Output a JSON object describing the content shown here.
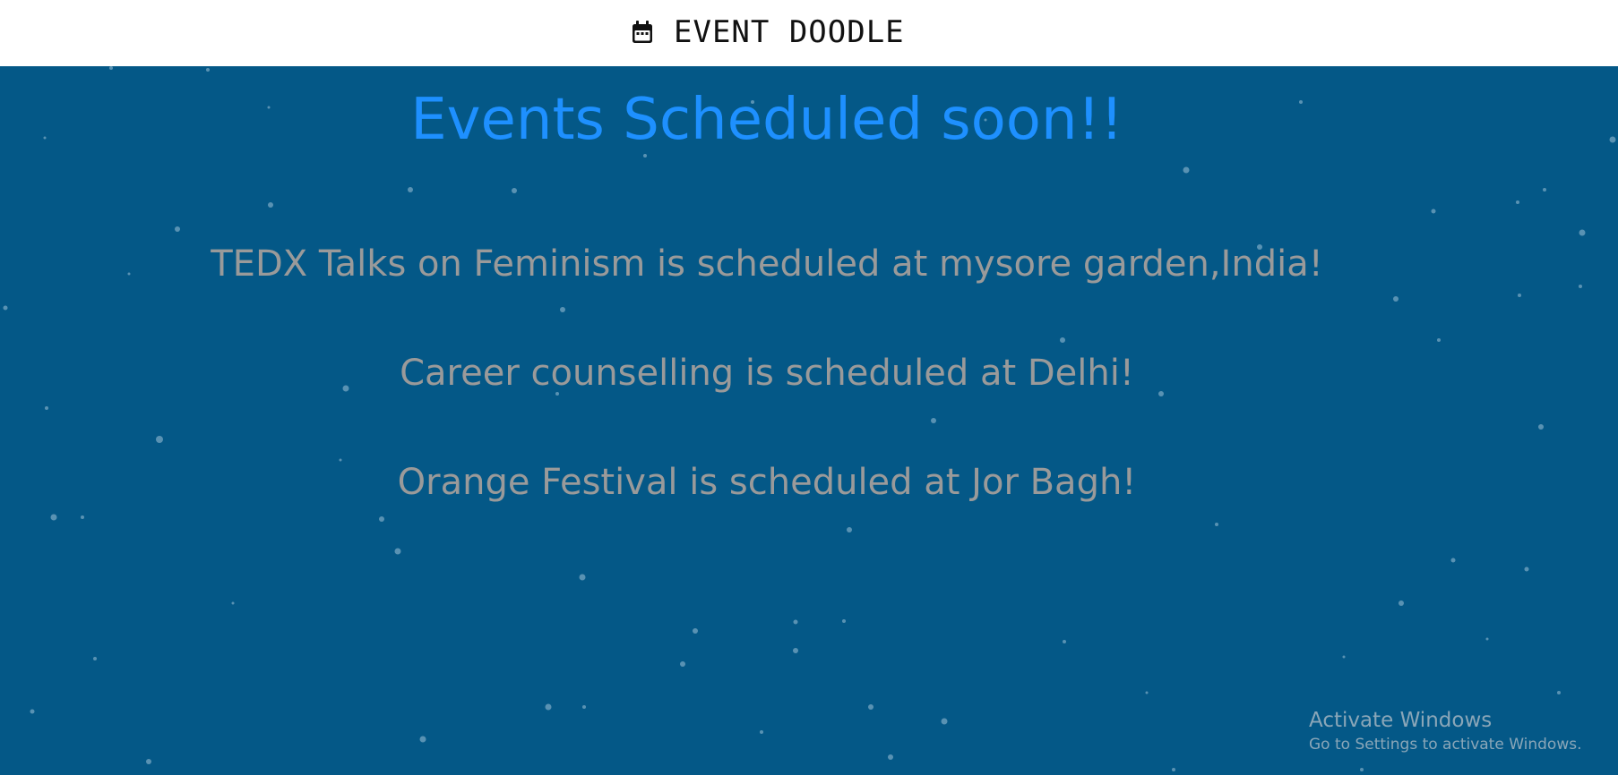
{
  "header": {
    "brand_icon": "calendar-icon",
    "brand_title": "EVENT DOODLE"
  },
  "main": {
    "heading": "Events Scheduled soon!!",
    "events": [
      "TEDX Talks on Feminism is scheduled at mysore garden,India!",
      "Career counselling is scheduled at Delhi!",
      "Orange Festival is scheduled at Jor Bagh!"
    ]
  },
  "watermark": {
    "title": "Activate Windows",
    "subtitle": "Go to Settings to activate Windows."
  },
  "colors": {
    "background": "#045887",
    "heading": "#1e90ff",
    "event_text": "#9a9a9a",
    "topbar": "#ffffff"
  }
}
